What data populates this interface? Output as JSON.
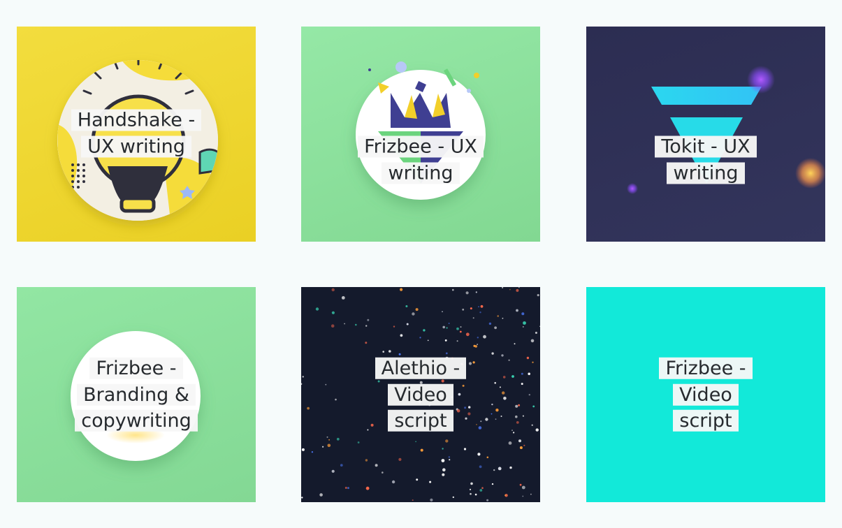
{
  "portfolio": {
    "cards": [
      {
        "title": "Handshake - UX writing",
        "art": "lightbulb-illustration"
      },
      {
        "title": "Frizbee - UX writing",
        "art": "frizbee-logo-confetti"
      },
      {
        "title": "Tokit - UX writing",
        "art": "tokit-triangle-logo"
      },
      {
        "title": "Frizbee - Branding & copywriting",
        "art": "frizbee-badge-circle"
      },
      {
        "title": "Alethio - Video script",
        "art": "starfield-dots"
      },
      {
        "title": "Frizbee - Video script",
        "art": "plain-turquoise"
      }
    ]
  },
  "colors": {
    "page_background": "#f6fbfb",
    "yellow": "#f0d731",
    "mint": "#8ee0a0",
    "navy": "#2e3056",
    "space": "#141a2c",
    "turquoise": "#12e9d9",
    "label_background": "#f7f7f7",
    "label_text": "#262a2e"
  }
}
